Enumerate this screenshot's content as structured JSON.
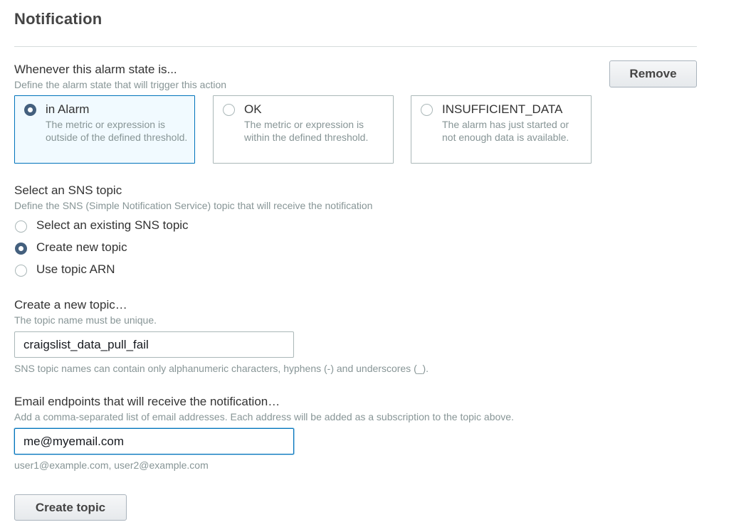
{
  "header": {
    "title": "Notification"
  },
  "alarm_state": {
    "label": "Whenever this alarm state is...",
    "description": "Define the alarm state that will trigger this action",
    "remove_label": "Remove",
    "options": [
      {
        "title": "in Alarm",
        "description": "The metric or expression is outside of the defined threshold.",
        "selected": true
      },
      {
        "title": "OK",
        "description": "The metric or expression is within the defined threshold.",
        "selected": false
      },
      {
        "title": "INSUFFICIENT_DATA",
        "description": "The alarm has just started or not enough data is available.",
        "selected": false
      }
    ]
  },
  "sns": {
    "label": "Select an SNS topic",
    "description": "Define the SNS (Simple Notification Service) topic that will receive the notification",
    "options": [
      {
        "label": "Select an existing SNS topic",
        "selected": false
      },
      {
        "label": "Create new topic",
        "selected": true
      },
      {
        "label": "Use topic ARN",
        "selected": false
      }
    ]
  },
  "new_topic": {
    "label": "Create a new topic…",
    "description": "The topic name must be unique.",
    "value": "craigslist_data_pull_fail",
    "hint": "SNS topic names can contain only alphanumeric characters, hyphens (-) and underscores (_)."
  },
  "email": {
    "label": "Email endpoints that will receive the notification…",
    "description": "Add a comma-separated list of email addresses. Each address will be added as a subscription to the topic above.",
    "value": "me@myemail.com",
    "hint": "user1@example.com, user2@example.com"
  },
  "actions": {
    "create_topic_label": "Create topic"
  },
  "colors": {
    "selected_border": "#0073bb",
    "selected_background": "#f1faff",
    "radio_checked": "#44607e"
  }
}
